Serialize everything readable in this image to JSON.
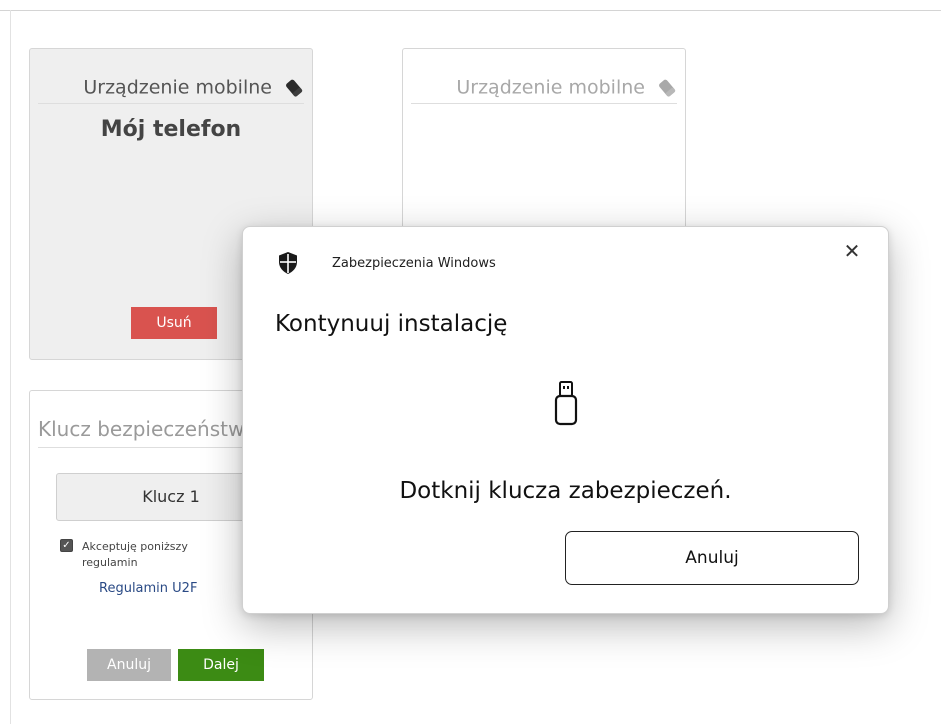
{
  "card_mobile": {
    "header": "Urządzenie mobilne",
    "icon": "eraser-icon",
    "device_name": "Mój telefon",
    "remove_label": "Usuń",
    "remove_color": "#d9534f"
  },
  "card_mobile_empty": {
    "header": "Urządzenie mobilne",
    "icon": "eraser-icon"
  },
  "card_security_key": {
    "header": "Klucz bezpieczeństwa",
    "key_name": "Klucz 1",
    "terms_checked": true,
    "terms_text": "Akceptuję poniższy regulamin",
    "terms_link": "Regulamin U2F",
    "cancel_label": "Anuluj",
    "next_label": "Dalej",
    "next_color": "#3c8b14"
  },
  "dialog": {
    "app_name": "Zabezpieczenia Windows",
    "app_icon": "shield-icon",
    "close_glyph": "✕",
    "title": "Kontynuuj instalację",
    "device_icon": "usb-key-icon",
    "message": "Dotknij klucza zabezpieczeń.",
    "cancel_label": "Anuluj"
  }
}
